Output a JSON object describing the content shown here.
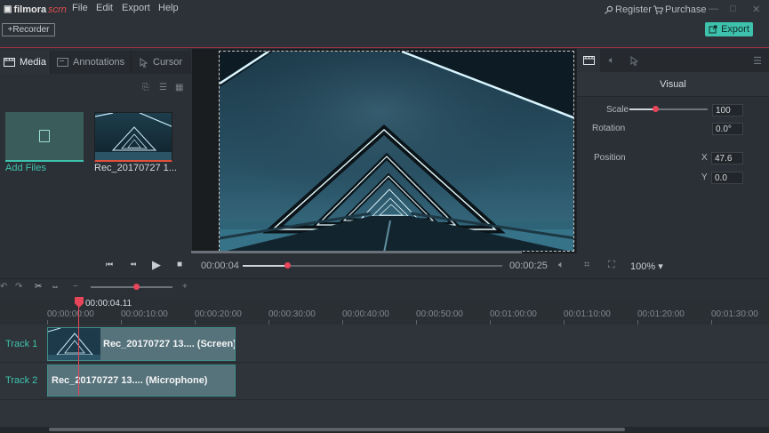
{
  "app": {
    "logo_icon": "film-icon",
    "logo_text_a": "filmora",
    "logo_text_b": "scrn",
    "menu": [
      "File",
      "Edit",
      "Export",
      "Help"
    ],
    "register_label": "Register",
    "purchase_label": "Purchase",
    "accent_color": "#3fc2ad",
    "highlight_color": "#e8445a"
  },
  "toolbar": {
    "recorder_label": "+Recorder",
    "export_label": "Export"
  },
  "left_panel": {
    "tabs": [
      {
        "label": "Media",
        "icon": "film-icon",
        "active": true
      },
      {
        "label": "Annotations",
        "icon": "annotation-icon",
        "active": false
      },
      {
        "label": "Cursor",
        "icon": "cursor-icon",
        "active": false
      }
    ],
    "add_files_label": "Add Files",
    "media_items": [
      {
        "label": "Rec_20170727 1..."
      }
    ]
  },
  "properties": {
    "title": "Visual",
    "scale_label": "Scale",
    "scale_value": "100",
    "rotation_label": "Rotation",
    "rotation_value": "0.0°",
    "position_label": "Position",
    "x_label": "X",
    "x_value": "47.6",
    "y_label": "Y",
    "y_value": "0.0"
  },
  "playback": {
    "current_time": "00:00:04",
    "end_time": "00:00:25",
    "zoom": "100% ▾",
    "progress_fraction": 0.16
  },
  "timeline": {
    "playhead_time": "00:00:04.11",
    "ruler_labels": [
      "00:00:00:00",
      "00:00:10:00",
      "00:00:20:00",
      "00:00:30:00",
      "00:00:40:00",
      "00:00:50:00",
      "00:01:00:00",
      "00:01:10:00",
      "00:01:20:00",
      "00:01:30:00"
    ],
    "tracks": [
      {
        "label": "Track 1",
        "clip": "Rec_20170727 13.... (Screen)"
      },
      {
        "label": "Track 2",
        "clip": "Rec_20170727 13.... (Microphone)"
      }
    ]
  }
}
